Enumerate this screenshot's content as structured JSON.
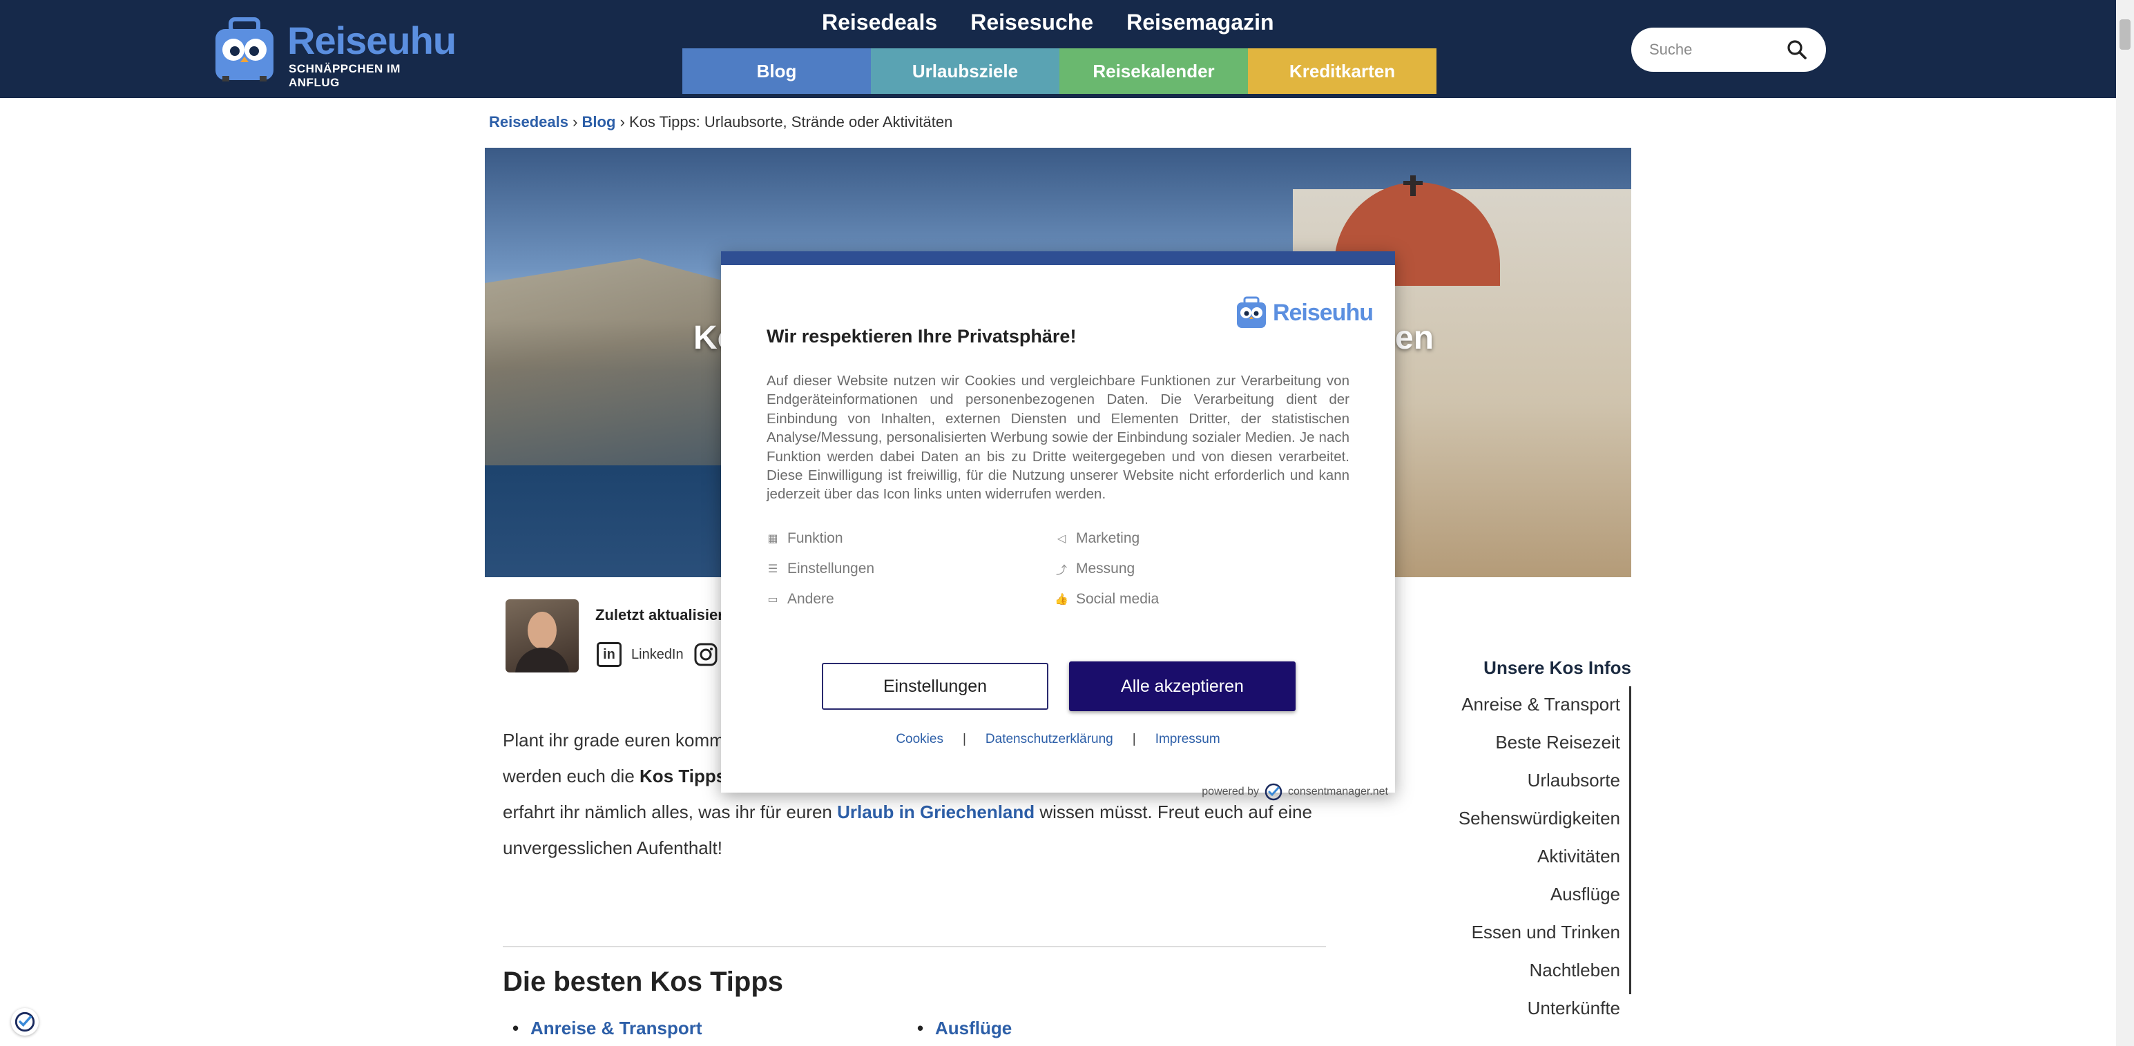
{
  "header": {
    "logo_name": "Reiseuhu",
    "logo_tagline": "SCHNÄPPCHEN IM ANFLUG",
    "top_nav": [
      "Reisedeals",
      "Reisesuche",
      "Reisemagazin"
    ],
    "category_nav": [
      {
        "label": "Blog",
        "color": "#4f7dc4"
      },
      {
        "label": "Urlaubsziele",
        "color": "#5aa3b3"
      },
      {
        "label": "Reisekalender",
        "color": "#6ab86f"
      },
      {
        "label": "Kreditkarten",
        "color": "#e1b53f"
      }
    ],
    "search_placeholder": "Suche",
    "background": "#16294a"
  },
  "breadcrumb": {
    "items": [
      "Reisedeals",
      "Blog"
    ],
    "separator": "›",
    "current": "Kos Tipps: Urlaubsorte, Strände oder Aktivitäten"
  },
  "hero": {
    "title_left": "Ko",
    "title_right": "en"
  },
  "author": {
    "updated_label": "Zuletzt aktualisiert",
    "linkedin_label": "LinkedIn",
    "instagram_label": "In"
  },
  "intro": {
    "line1_start": "Plant ihr grade euren komm",
    "line2_start": "werden euch die ",
    "line2_bold": "Kos Tipps",
    "line3_start": "erfahrt ihr nämlich alles, was ihr für euren ",
    "line3_link": "Urlaub in Griechenland",
    "line3_end": " wissen müsst. Freut euch auf eine",
    "line4": "unvergesslichen Aufenthalt!"
  },
  "section": {
    "heading": "Die besten Kos Tipps",
    "links": [
      "Anreise & Transport",
      "Ausflüge"
    ]
  },
  "sidebar": {
    "title": "Unsere Kos Infos",
    "items": [
      "Anreise & Transport",
      "Beste Reisezeit",
      "Urlaubsorte",
      "Sehenswürdigkeiten",
      "Aktivitäten",
      "Ausflüge",
      "Essen und Trinken",
      "Nachtleben",
      "Unterkünfte"
    ]
  },
  "consent": {
    "logo_name": "Reiseuhu",
    "title": "Wir respektieren Ihre Privatsphäre!",
    "text": "Auf dieser Website nutzen wir Cookies und vergleichbare Funktionen zur Verarbeitung von Endgeräteinformationen und personenbezogenen Daten. Die Verarbeitung dient der Einbindung von Inhalten, externen Diensten und Elementen Dritter, der statistischen Analyse/Messung, personalisierten Werbung sowie der Einbindung sozialer Medien. Je nach Funktion werden dabei Daten an bis zu Dritte weitergegeben und von diesen verarbeitet. Diese Einwilligung ist freiwillig, für die Nutzung unserer Website nicht erforderlich und kann jederzeit über das Icon links unten widerrufen werden.",
    "purposes": [
      {
        "label": "Funktion",
        "icon": "grid-icon"
      },
      {
        "label": "Marketing",
        "icon": "megaphone-icon"
      },
      {
        "label": "Einstellungen",
        "icon": "sliders-icon"
      },
      {
        "label": "Messung",
        "icon": "chart-icon"
      },
      {
        "label": "Andere",
        "icon": "chat-icon"
      },
      {
        "label": "Social media",
        "icon": "thumbs-up-icon"
      }
    ],
    "settings_button": "Einstellungen",
    "accept_button": "Alle akzeptieren",
    "links": [
      "Cookies",
      "Datenschutzerklärung",
      "Impressum"
    ],
    "link_separator": "|",
    "powered_by": "powered by",
    "powered_brand": "consentmanager.net",
    "accent": "#1a0d6b"
  }
}
